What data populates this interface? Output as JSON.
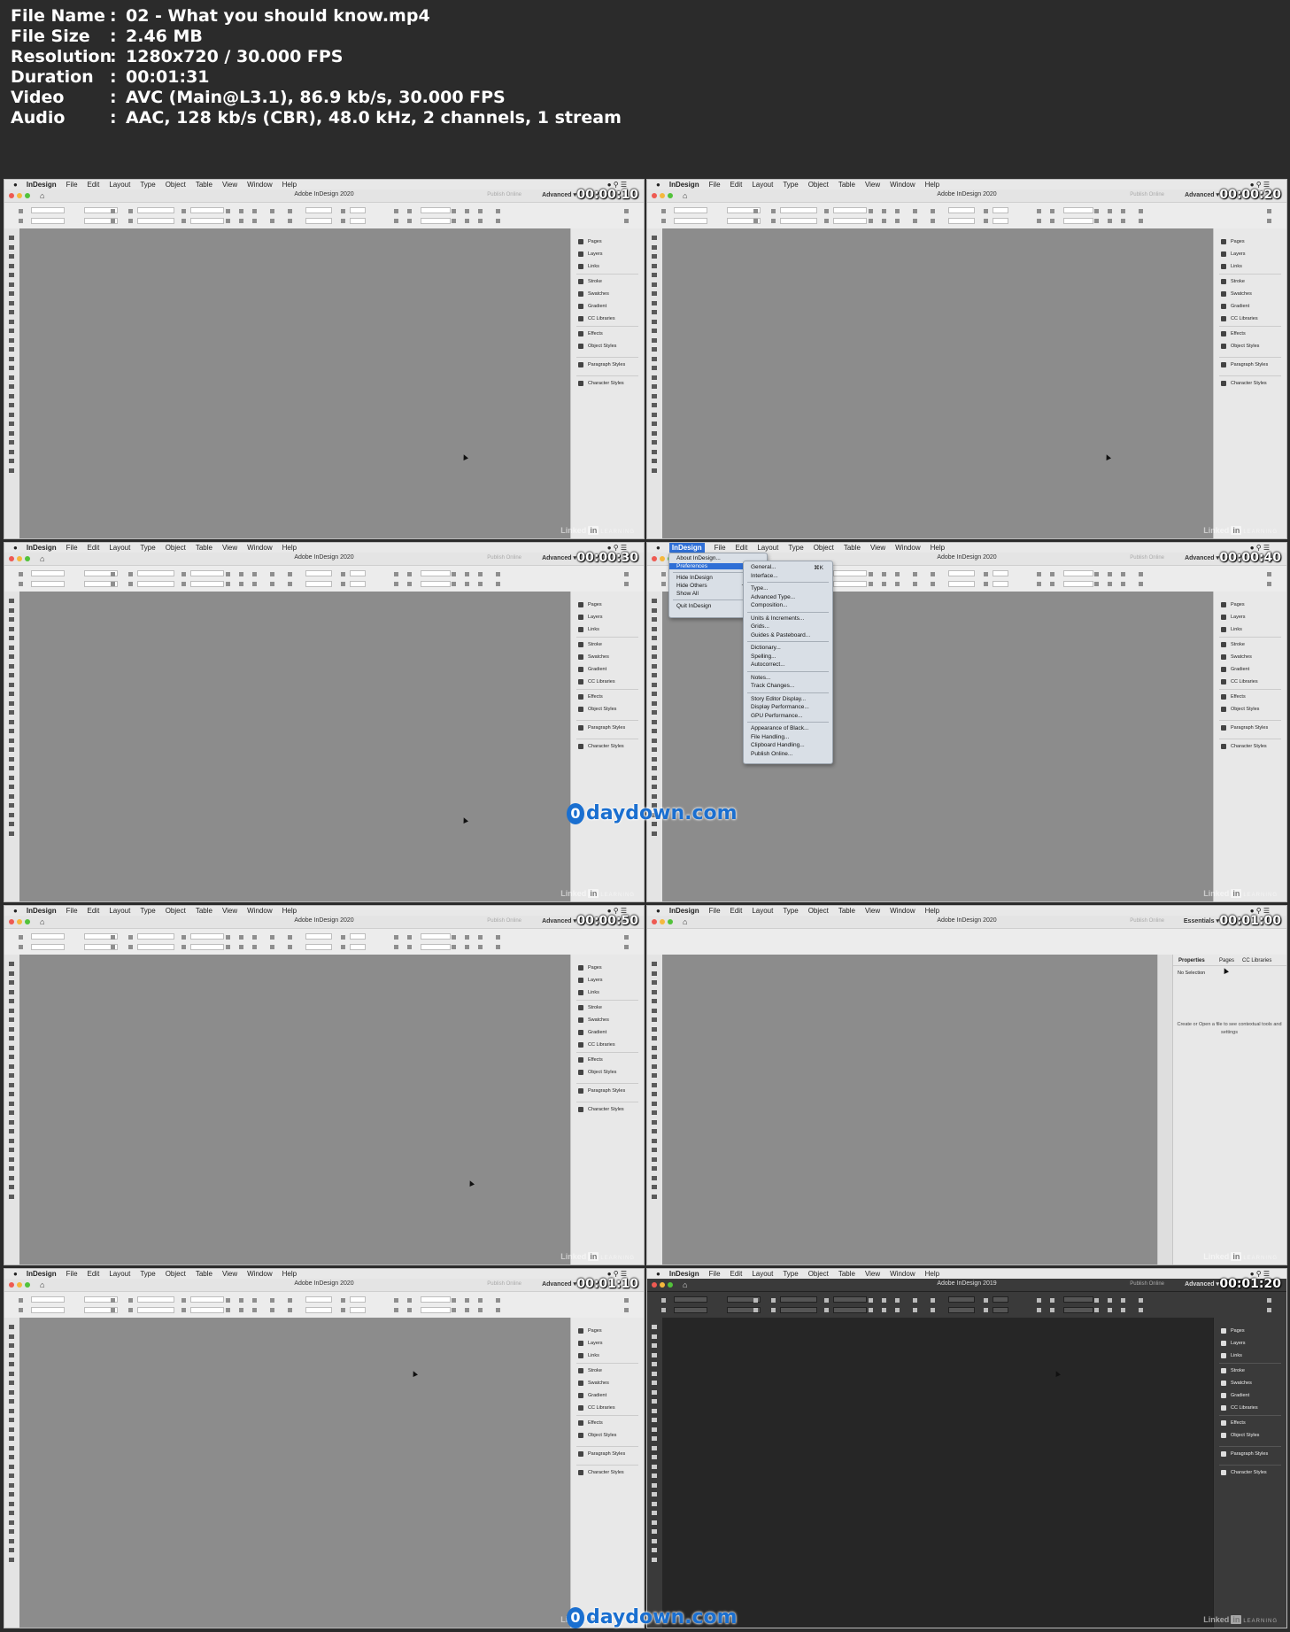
{
  "info": [
    {
      "key": "File Name",
      "value": "02 - What you should know.mp4"
    },
    {
      "key": "File Size",
      "value": "2.46 MB"
    },
    {
      "key": "Resolution",
      "value": "1280x720 / 30.000 FPS"
    },
    {
      "key": "Duration",
      "value": "00:01:31"
    },
    {
      "key": "Video",
      "value": "AVC (Main@L3.1), 86.9 kb/s, 30.000 FPS"
    },
    {
      "key": "Audio",
      "value": "AAC, 128 kb/s (CBR), 48.0 kHz, 2 channels, 1 stream"
    }
  ],
  "colon": ":",
  "menubar": {
    "apple": "",
    "app": "InDesign",
    "items": [
      "File",
      "Edit",
      "Layout",
      "Type",
      "Object",
      "Table",
      "View",
      "Window",
      "Help"
    ]
  },
  "toolbar": {
    "publish": "Publish Online",
    "workspace_advanced": "Advanced",
    "workspace_essentials": "Essentials"
  },
  "panels": [
    "Pages",
    "Layers",
    "Links",
    "Stroke",
    "Swatches",
    "Gradient",
    "CC Libraries",
    "Effects",
    "Object Styles",
    "Paragraph Styles",
    "Character Styles"
  ],
  "properties": {
    "tabs": [
      "Properties",
      "Pages",
      "CC Libraries"
    ],
    "no_selection": "No Selection",
    "message": "Create or Open a file to see contextual tools and settings"
  },
  "linkedin": {
    "word": "Linked",
    "in": "in",
    "learning": "LEARNING"
  },
  "frames": [
    {
      "timestamp": "00:00:10",
      "title": "Adobe InDesign 2020",
      "theme": "light",
      "workspace": "advanced"
    },
    {
      "timestamp": "00:00:20",
      "title": "Adobe InDesign 2020",
      "theme": "light",
      "workspace": "advanced"
    },
    {
      "timestamp": "00:00:30",
      "title": "Adobe InDesign 2020",
      "theme": "light",
      "workspace": "advanced"
    },
    {
      "timestamp": "00:00:40",
      "title": "Adobe InDesign 2020",
      "theme": "light",
      "workspace": "advanced",
      "menu_open": true
    },
    {
      "timestamp": "00:00:50",
      "title": "Adobe InDesign 2020",
      "theme": "light",
      "workspace": "advanced"
    },
    {
      "timestamp": "00:01:00",
      "title": "Adobe InDesign 2020",
      "theme": "light",
      "workspace": "essentials"
    },
    {
      "timestamp": "00:01:10",
      "title": "Adobe InDesign 2020",
      "theme": "light",
      "workspace": "advanced"
    },
    {
      "timestamp": "00:01:20",
      "title": "Adobe InDesign 2019",
      "theme": "dark",
      "workspace": "advanced"
    }
  ],
  "app_menu": {
    "items": [
      {
        "label": "About InDesign...",
        "shortcut": ""
      },
      {
        "label": "Preferences",
        "shortcut": "",
        "highlighted": true
      },
      {
        "label": "Hide InDesign",
        "shortcut": "⌘H"
      },
      {
        "label": "Hide Others",
        "shortcut": "⌥⌘H"
      },
      {
        "label": "Show All",
        "shortcut": ""
      },
      {
        "label": "Quit InDesign",
        "shortcut": "⌘Q"
      }
    ]
  },
  "prefs_menu": {
    "items": [
      "General...",
      "Interface...",
      "Type...",
      "Advanced Type...",
      "Composition...",
      "Units & Increments...",
      "Grids...",
      "Guides & Pasteboard...",
      "Dictionary...",
      "Spelling...",
      "Autocorrect...",
      "Notes...",
      "Track Changes...",
      "Story Editor Display...",
      "Display Performance...",
      "GPU Performance...",
      "Appearance of Black...",
      "File Handling...",
      "Clipboard Handling...",
      "Publish Online..."
    ],
    "general_shortcut": "⌘K"
  },
  "watermark": {
    "mark": "0",
    "text": "daydown.com"
  }
}
